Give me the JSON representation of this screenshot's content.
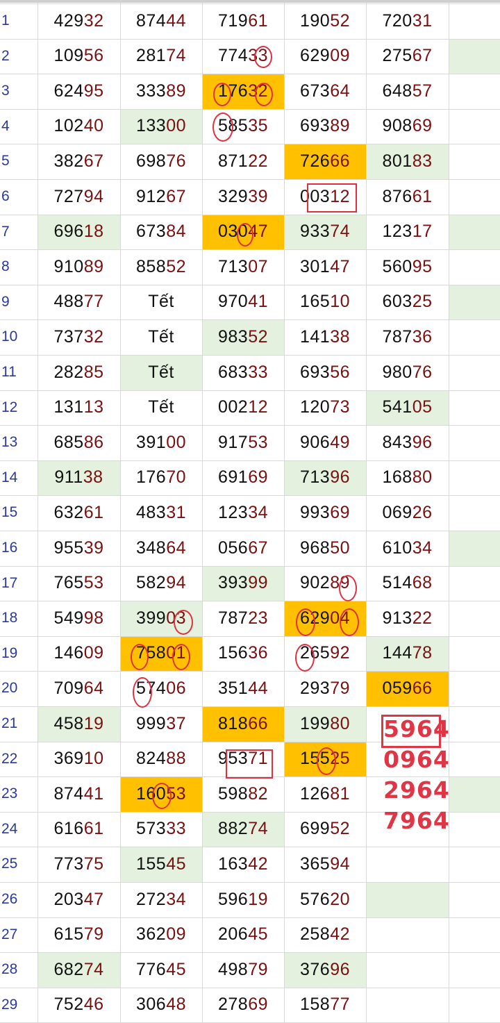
{
  "rows": [
    {
      "n": "1",
      "cells": [
        "42932",
        "87444",
        "71961",
        "19052",
        "72031"
      ]
    },
    {
      "n": "2",
      "cells": [
        "10956",
        "28174",
        "77433",
        "62909",
        "27567"
      ]
    },
    {
      "n": "3",
      "cells": [
        "62495",
        "33389",
        "17632",
        "67364",
        "64857"
      ]
    },
    {
      "n": "4",
      "cells": [
        "10240",
        "13300",
        "58535",
        "69389",
        "90869"
      ]
    },
    {
      "n": "5",
      "cells": [
        "38267",
        "69876",
        "87122",
        "72666",
        "80183"
      ]
    },
    {
      "n": "6",
      "cells": [
        "72794",
        "91267",
        "32939",
        "00312",
        "87661"
      ]
    },
    {
      "n": "7",
      "cells": [
        "69618",
        "67384",
        "03047",
        "93374",
        "12317"
      ]
    },
    {
      "n": "8",
      "cells": [
        "91089",
        "85852",
        "71307",
        "30147",
        "56095"
      ]
    },
    {
      "n": "9",
      "cells": [
        "48877",
        "Tết",
        "97041",
        "16510",
        "60325"
      ]
    },
    {
      "n": "10",
      "cells": [
        "73732",
        "Tết",
        "98352",
        "14138",
        "78736"
      ]
    },
    {
      "n": "11",
      "cells": [
        "28285",
        "Tết",
        "68333",
        "69356",
        "98076"
      ]
    },
    {
      "n": "12",
      "cells": [
        "13113",
        "Tết",
        "00212",
        "12073",
        "54105"
      ]
    },
    {
      "n": "13",
      "cells": [
        "68586",
        "39100",
        "91753",
        "90649",
        "84396"
      ]
    },
    {
      "n": "14",
      "cells": [
        "91138",
        "17670",
        "69169",
        "71396",
        "16880"
      ]
    },
    {
      "n": "15",
      "cells": [
        "63261",
        "48331",
        "12334",
        "99369",
        "06926"
      ]
    },
    {
      "n": "16",
      "cells": [
        "95539",
        "34864",
        "05667",
        "96850",
        "61034"
      ]
    },
    {
      "n": "17",
      "cells": [
        "76553",
        "58294",
        "39399",
        "90289",
        "51468"
      ]
    },
    {
      "n": "18",
      "cells": [
        "54998",
        "39903",
        "78723",
        "62904",
        "91322"
      ]
    },
    {
      "n": "19",
      "cells": [
        "14609",
        "75801",
        "15636",
        "26592",
        "14478"
      ]
    },
    {
      "n": "20",
      "cells": [
        "70964",
        "57406",
        "35144",
        "29379",
        "05966"
      ]
    },
    {
      "n": "21",
      "cells": [
        "45819",
        "99937",
        "81866",
        "19980",
        ""
      ]
    },
    {
      "n": "22",
      "cells": [
        "36910",
        "82488",
        "95371",
        "15525",
        ""
      ]
    },
    {
      "n": "23",
      "cells": [
        "87441",
        "16053",
        "59882",
        "12681",
        ""
      ]
    },
    {
      "n": "24",
      "cells": [
        "61661",
        "57333",
        "88274",
        "69952",
        ""
      ]
    },
    {
      "n": "25",
      "cells": [
        "77375",
        "15545",
        "16342",
        "36594",
        ""
      ]
    },
    {
      "n": "26",
      "cells": [
        "20347",
        "27234",
        "59619",
        "57620",
        ""
      ]
    },
    {
      "n": "27",
      "cells": [
        "61579",
        "36209",
        "20645",
        "25842",
        ""
      ]
    },
    {
      "n": "28",
      "cells": [
        "68274",
        "77645",
        "49879",
        "37696",
        ""
      ]
    },
    {
      "n": "29",
      "cells": [
        "75246",
        "30648",
        "27869",
        "15877",
        ""
      ]
    }
  ],
  "green_cells": [
    [
      2,
      5
    ],
    [
      4,
      1
    ],
    [
      5,
      4
    ],
    [
      7,
      0
    ],
    [
      7,
      3
    ],
    [
      10,
      2
    ],
    [
      11,
      1
    ],
    [
      12,
      4
    ],
    [
      14,
      0
    ],
    [
      14,
      3
    ],
    [
      17,
      2
    ],
    [
      18,
      1
    ],
    [
      19,
      4
    ],
    [
      21,
      0
    ],
    [
      21,
      3
    ],
    [
      24,
      2
    ],
    [
      25,
      1
    ],
    [
      26,
      4
    ],
    [
      28,
      0
    ],
    [
      28,
      3
    ],
    [
      9,
      5
    ],
    [
      16,
      5
    ],
    [
      23,
      5
    ],
    [
      7,
      5
    ],
    [
      2,
      5
    ]
  ],
  "orange_cells": [
    [
      3,
      2
    ],
    [
      5,
      3
    ],
    [
      7,
      2
    ],
    [
      18,
      3
    ],
    [
      19,
      1
    ],
    [
      20,
      4
    ],
    [
      21,
      2
    ],
    [
      22,
      3
    ],
    [
      23,
      1
    ]
  ],
  "handwritten_notes": [
    "5964",
    "0964",
    "2964",
    "7964"
  ],
  "colors": {
    "lead": "#111111",
    "tail": "#7a1010",
    "green": "#e3f1de",
    "orange": "#ffc000",
    "ink": "#e03040",
    "rownum": "#2a3a99"
  }
}
